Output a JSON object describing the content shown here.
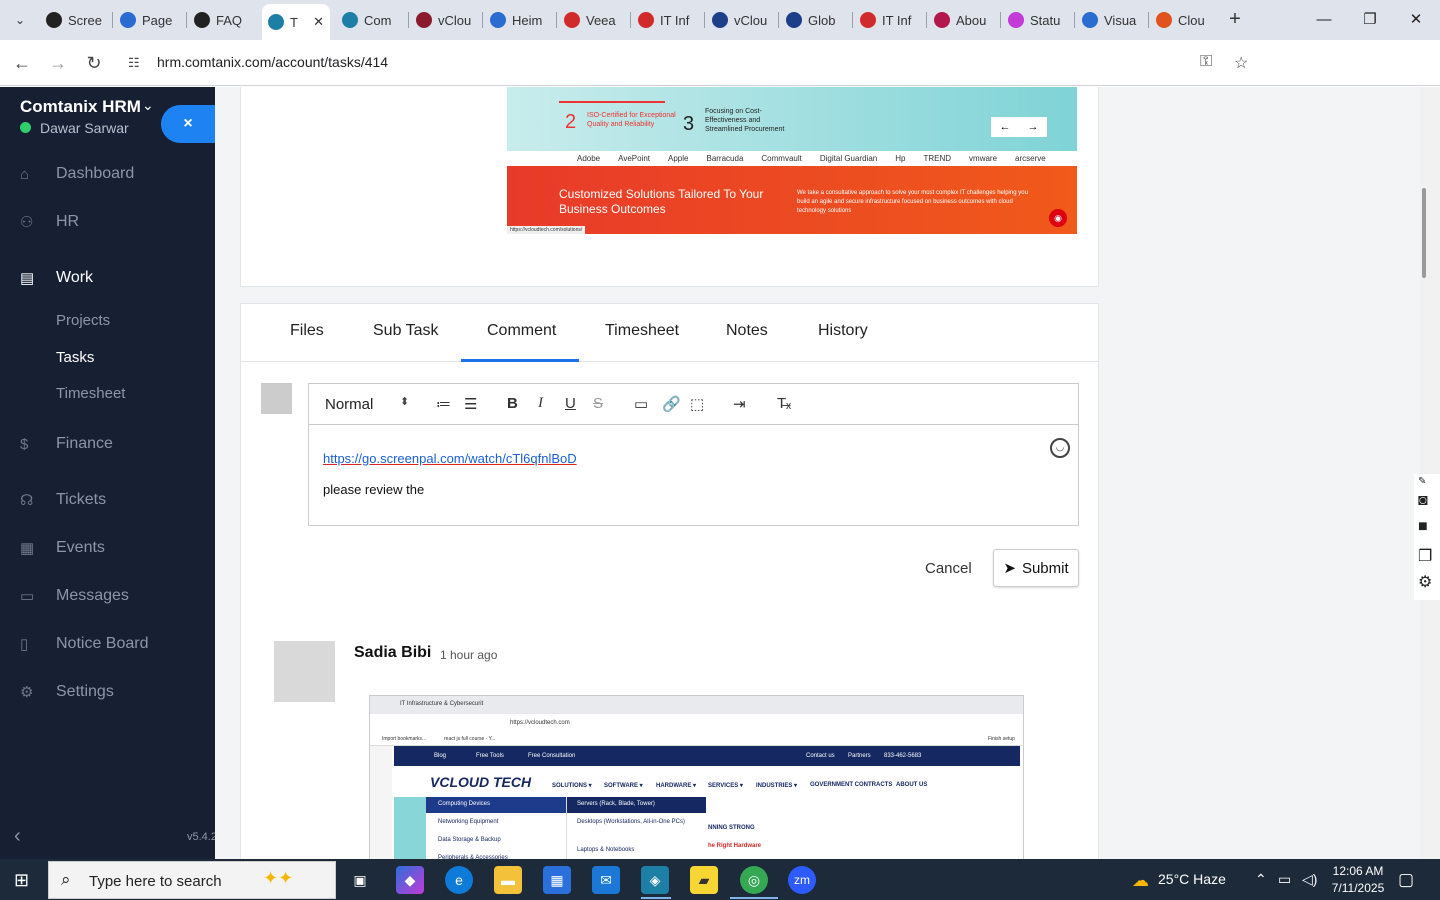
{
  "browser": {
    "tabs": [
      {
        "label": "Scree",
        "color": "#222"
      },
      {
        "label": "Page",
        "color": "#2b6cd1"
      },
      {
        "label": "FAQ",
        "color": "#222"
      },
      {
        "label": "T",
        "color": "#1e7fa6"
      },
      {
        "label": "Com",
        "color": "#1e7fa6"
      },
      {
        "label": "vClou",
        "color": "#8a1b2d"
      },
      {
        "label": "Heim",
        "color": "#2b6cd1"
      },
      {
        "label": "Veea",
        "color": "#d12a2a"
      },
      {
        "label": "IT Inf",
        "color": "#d12a2a"
      },
      {
        "label": "vClou",
        "color": "#1d3f8a"
      },
      {
        "label": "Glob",
        "color": "#1d3f8a"
      },
      {
        "label": "IT Inf",
        "color": "#d12a2a"
      },
      {
        "label": "Abou",
        "color": "#b3164a"
      },
      {
        "label": "Statu",
        "color": "#c23bd6"
      },
      {
        "label": "Visua",
        "color": "#2b6cd1"
      },
      {
        "label": "Clou",
        "color": "#e0531f"
      }
    ],
    "url": "hrm.comtanix.com/account/tasks/414",
    "profile_initial": "t"
  },
  "sidebar": {
    "brand": "Comtanix HRM",
    "user": "Dawar Sarwar",
    "close_label": "×",
    "items": [
      {
        "label": "Dashboard",
        "icon": "⌂"
      },
      {
        "label": "HR",
        "icon": "👥"
      },
      {
        "label": "Work",
        "icon": "💼"
      },
      {
        "label": "Finance",
        "icon": "$"
      },
      {
        "label": "Tickets",
        "icon": "🎧"
      },
      {
        "label": "Events",
        "icon": "📅"
      },
      {
        "label": "Messages",
        "icon": "💬"
      },
      {
        "label": "Notice Board",
        "icon": "📋"
      },
      {
        "label": "Settings",
        "icon": "⚙"
      }
    ],
    "sub_items": [
      "Projects",
      "Tasks",
      "Timesheet"
    ],
    "version": "v5.4.2"
  },
  "banner": {
    "num2": "2",
    "text2": "ISO-Certified for Exceptional Quality and Reliability",
    "num3": "3",
    "text3": "Focusing on Cost-Effectiveness and Streamlined Procurement",
    "logos": [
      "Adobe",
      "AvePoint",
      "Apple",
      "Barracuda",
      "Commvault",
      "Digital Guardian",
      "Hp",
      "TREND",
      "vmware",
      "arcserve"
    ],
    "headline": "Customized Solutions Tailored To Your Business Outcomes",
    "paragraph": "We take a consultative approach to solve your most complex IT challenges helping you build an agile and secure infrastructure focused on business outcomes with cloud technology solutions",
    "url_tip": "https://vcloudtech.com/solutions/"
  },
  "task_tabs": [
    "Files",
    "Sub Task",
    "Comment",
    "Timesheet",
    "Notes",
    "History"
  ],
  "editor": {
    "format": "Normal",
    "link": "https://go.screenpal.com/watch/cTl6qfnlBoD",
    "text": "please review the"
  },
  "actions": {
    "cancel": "Cancel",
    "submit": "Submit"
  },
  "comment": {
    "author": "Sadia Bibi",
    "time": "1 hour ago",
    "shot": {
      "tab_title": "IT Infrastructure & Cybersecurit",
      "url": "https://vcloudtech.com",
      "bookmarks": "Import bookmarks...",
      "bookmark2": "react js full course - Y...",
      "finish": "Finish setup",
      "nav1": [
        "Blog",
        "Free Tools",
        "Free Consultation",
        "Contact us",
        "Partners",
        "833-462-5683"
      ],
      "logo": "VCLOUD TECH",
      "nav2": [
        "SOLUTIONS ▾",
        "SOFTWARE ▾",
        "HARDWARE ▾",
        "SERVICES ▾",
        "INDUSTRIES ▾",
        "GOVERNMENT CONTRACTS",
        "ABOUT US"
      ],
      "menu": [
        "Computing Devices",
        "Networking Equipment",
        "Data Storage & Backup",
        "Peripherals & Accessories"
      ],
      "submenu": [
        "Servers (Rack, Blade, Tower)",
        "Desktops (Workstations, All-in-One PCs)",
        "Laptops & Notebooks"
      ],
      "hero1": "NNING STRONG",
      "hero2": "he Right Hardware"
    }
  },
  "taskbar": {
    "search_placeholder": "Type here to search",
    "weather": "25°C  Haze",
    "time": "12:06 AM",
    "date": "7/11/2025"
  }
}
